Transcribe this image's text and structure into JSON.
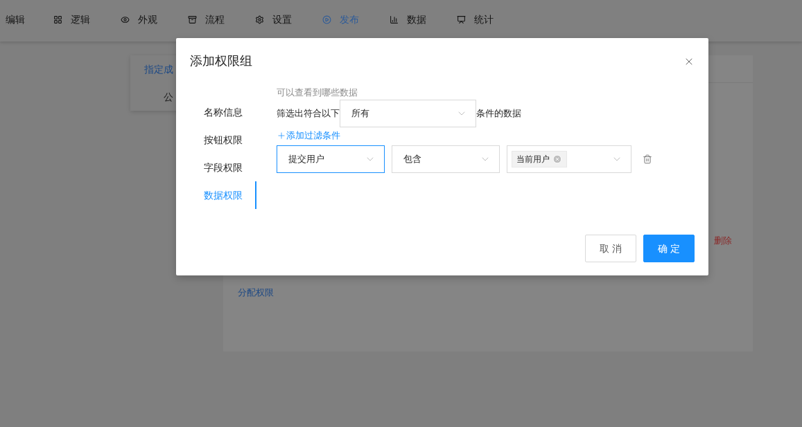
{
  "nav": {
    "tabs": [
      {
        "label": "编辑",
        "selected": false
      },
      {
        "label": "逻辑",
        "selected": false
      },
      {
        "label": "外观",
        "selected": false
      },
      {
        "label": "流程",
        "selected": false
      },
      {
        "label": "设置",
        "selected": false
      },
      {
        "label": "发布",
        "selected": true
      },
      {
        "label": "数据",
        "selected": false
      },
      {
        "label": "统计",
        "selected": false
      }
    ]
  },
  "background": {
    "side_tabs": [
      {
        "label": "指定成",
        "selected": true
      },
      {
        "label": "公",
        "selected": false
      }
    ],
    "delete_link": "删除",
    "assign_link": "分配权限"
  },
  "dialog": {
    "title": "添加权限组",
    "side_tabs": [
      {
        "label": "名称信息",
        "selected": false
      },
      {
        "label": "按钮权限",
        "selected": false
      },
      {
        "label": "字段权限",
        "selected": false
      },
      {
        "label": "数据权限",
        "selected": true
      }
    ],
    "hint": "可以查看到哪些数据",
    "filter_prefix": "筛选出符合以下",
    "match_select": "所有",
    "filter_suffix": "条件的数据",
    "add_filter": "添加过滤条件",
    "conditions": [
      {
        "field": "提交用户",
        "field_focused": true,
        "operator": "包含",
        "values": [
          "当前用户"
        ]
      }
    ],
    "buttons": [
      {
        "label": "取 消",
        "primary": false
      },
      {
        "label": "确 定",
        "primary": true
      }
    ]
  }
}
